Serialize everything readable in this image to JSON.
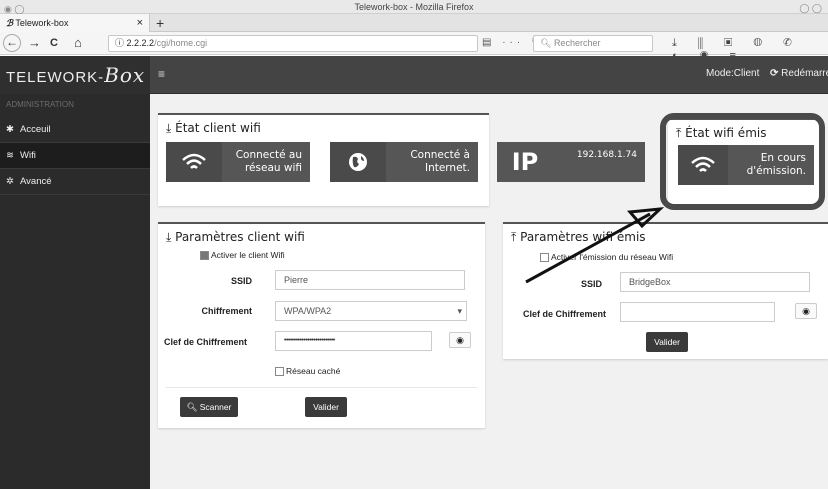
{
  "window": {
    "title": "Telework-box - Mozilla Firefox"
  },
  "tab": {
    "label": "Telework-box",
    "close": "×",
    "new": "+"
  },
  "nav": {
    "back": "←",
    "forward": "→",
    "reload": "C",
    "home": "⌂",
    "info": "ⓘ",
    "url_host": "2.2.2.2",
    "url_path": "/cgi/home.cgi",
    "search_placeholder": "Rechercher",
    "page_actions": "▤ ··· ♡ ☆"
  },
  "brand": {
    "text": "TELEWORK-",
    "script": "Box"
  },
  "header": {
    "menu": "≡",
    "mode": "Mode:Client",
    "restart_icon": "⟳",
    "restart": "Redémarrer"
  },
  "sidebar": {
    "section": "ADMINISTRATION",
    "items": [
      {
        "icon": "✱",
        "label": "Acceuil"
      },
      {
        "icon": "≋",
        "label": "Wifi"
      },
      {
        "icon": "✲",
        "label": "Avancé"
      }
    ]
  },
  "client_status": {
    "title": "État client wifi",
    "tiles": [
      {
        "icon": "wifi-icon",
        "line1": "Connecté au",
        "line2": "réseau wifi"
      },
      {
        "icon": "globe-icon",
        "line1": "Connecté à",
        "line2": "Internet."
      },
      {
        "icon": "ip",
        "icon_text": "IP",
        "line1": "192.168.1.74",
        "line2": ""
      }
    ]
  },
  "emit_status": {
    "title": "État wifi émis",
    "tile": {
      "line1": "En cours",
      "line2": "d'émission."
    }
  },
  "client_params": {
    "title": "Paramètres client wifi",
    "enable_label": "Activer le client Wifi",
    "enable_checked": true,
    "ssid_label": "SSID",
    "ssid_value": "Pierre",
    "cipher_label": "Chiffrement",
    "cipher_value": "WPA/WPA2",
    "key_label": "Clef de Chiffrement",
    "key_value": "••••••••••••••••••••••••••",
    "hidden_label": "Réseau caché",
    "hidden_checked": false,
    "scan_label": "Scanner",
    "submit_label": "Valider"
  },
  "emit_params": {
    "title": "Paramètres wifi émis",
    "enable_label": "Activer l'émission du réseau Wifi",
    "enable_checked": false,
    "ssid_label": "SSID",
    "ssid_value": "BridgeBox",
    "key_label": "Clef de Chiffrement",
    "key_value": "",
    "submit_label": "Valider"
  }
}
